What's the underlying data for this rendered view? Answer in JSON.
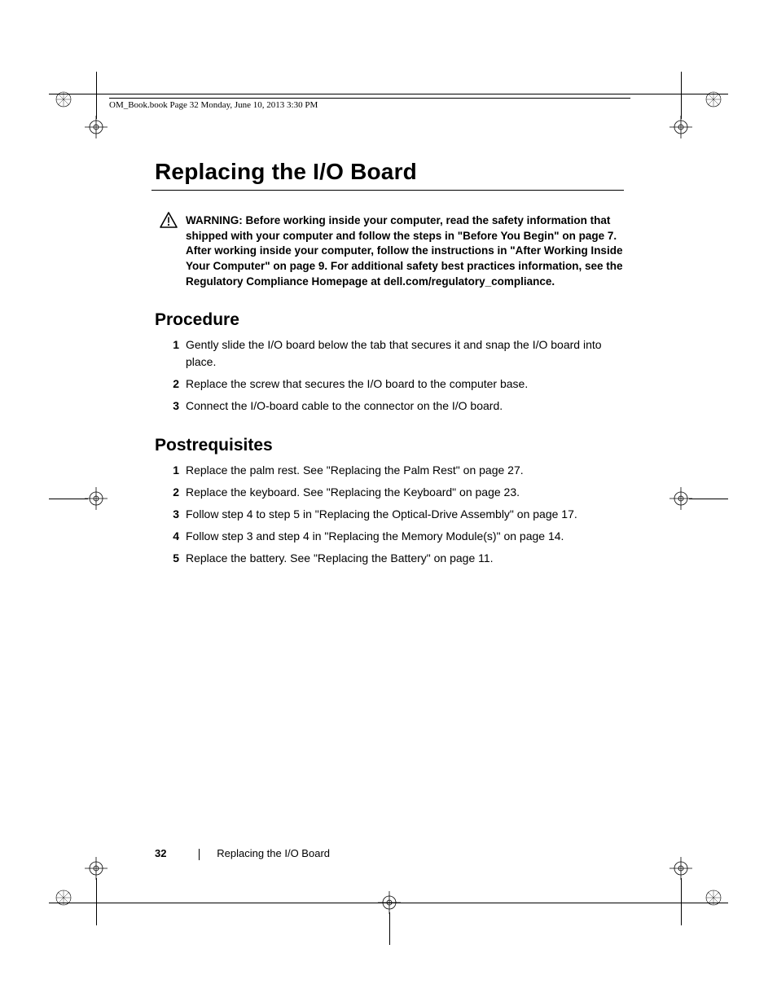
{
  "runhead": "OM_Book.book  Page 32  Monday, June 10, 2013  3:30 PM",
  "title": "Replacing the I/O Board",
  "warning_label": "WARNING:  ",
  "warning_text": "Before working inside your computer, read the safety information that shipped with your computer and follow the steps in \"Before You Begin\" on page 7. After working inside your computer, follow the instructions in \"After Working Inside Your Computer\" on page 9. For additional safety best practices information, see the Regulatory Compliance Homepage at dell.com/regulatory_compliance.",
  "sections": {
    "procedure": {
      "heading": "Procedure",
      "steps": [
        "Gently slide the I/O board below the tab that secures it and snap the I/O board into place.",
        "Replace the screw that secures the I/O board to the computer base.",
        "Connect the I/O-board cable to the connector on the I/O board."
      ]
    },
    "postreq": {
      "heading": "Postrequisites",
      "steps": [
        "Replace the palm rest. See \"Replacing the Palm Rest\" on page 27.",
        "Replace the keyboard. See \"Replacing the Keyboard\" on page 23.",
        "Follow step 4 to step 5 in \"Replacing the Optical-Drive Assembly\" on page 17.",
        "Follow step 3 and step 4 in \"Replacing the Memory Module(s)\" on page 14.",
        "Replace the battery. See \"Replacing the Battery\" on page 11."
      ]
    }
  },
  "footer": {
    "page_number": "32",
    "section_title": "Replacing the I/O Board"
  }
}
